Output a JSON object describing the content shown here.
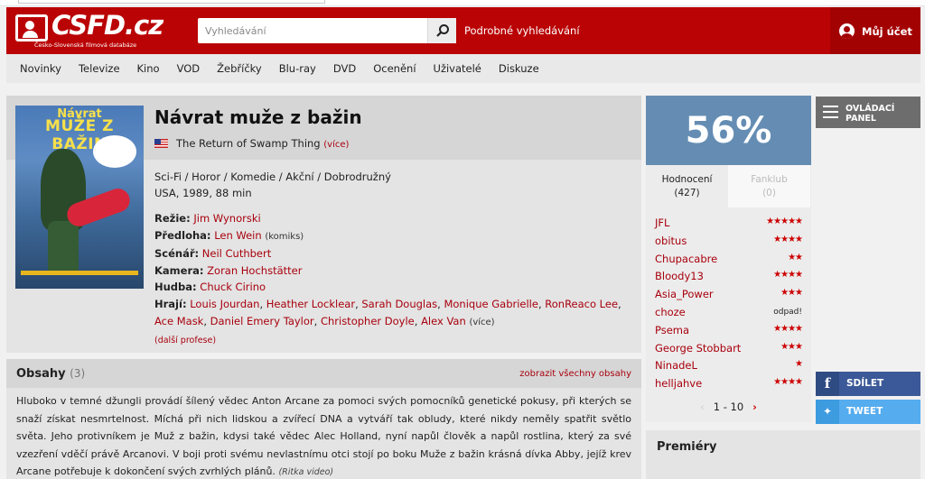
{
  "header": {
    "logo_text": "CSFD.cz",
    "logo_tagline": "Česko-Slovenská filmová databáze",
    "search_placeholder": "Vyhledávání",
    "advanced_search": "Podrobné vyhledávání",
    "account_label": "Můj účet",
    "brand_color": "#ba0305"
  },
  "nav": [
    "Novinky",
    "Televize",
    "Kino",
    "VOD",
    "Žebříčky",
    "Blu-ray",
    "DVD",
    "Ocenění",
    "Uživatelé",
    "Diskuze"
  ],
  "film": {
    "title": "Návrat muže z bažin",
    "poster_title_line1": "Návrat",
    "poster_title_line2": "MUŽE Z BAŽIN",
    "original_title": "The Return of Swamp Thing",
    "original_more": "(více)",
    "genres": "Sci-Fi / Horor / Komedie / Akční / Dobrodružný",
    "origin": "USA, 1989, 88 min",
    "directing_label": "Režie:",
    "director": "Jim Wynorski",
    "source_label": "Předloha:",
    "source": "Len Wein",
    "source_note": "(komiks)",
    "writer_label": "Scénář:",
    "writer": "Neil Cuthbert",
    "camera_label": "Kamera:",
    "camera": "Zoran Hochstätter",
    "music_label": "Hudba:",
    "music": "Chuck Cirino",
    "cast_label": "Hrají:",
    "cast": [
      "Louis Jourdan",
      "Heather Locklear",
      "Sarah Douglas",
      "Monique Gabrielle",
      "RonReaco Lee",
      "Ace Mask",
      "Daniel Emery Taylor",
      "Christopher Doyle",
      "Alex Van"
    ],
    "cast_more": "(více)",
    "more_professions": "(další profese)"
  },
  "plot": {
    "heading": "Obsahy",
    "count": "(3)",
    "show_all": "zobrazit všechny obsahy",
    "text": "Hluboko v temné džungli provádí šílený vědec Anton Arcane za pomoci svých pomocníků genetické pokusy, při kterých se snaží získat nesmrtelnost. Míchá při nich lidskou a zvířecí DNA a vytváří tak obludy, které nikdy neměly spatřit světlo světa. Jeho protivníkem je Muž z bažin, kdysi také vědec Alec Holland, nyní napůl člověk a napůl rostlina, který za své vzezření vděčí právě Arcanovi. V boji proti svému nevlastnímu otci stojí po boku Muže z bažin krásná dívka Abby, jejíž krev Arcane potřebuje k dokončení svých zvrhlých plánů.",
    "source": "(Ritka video)"
  },
  "rating": {
    "score": "56%",
    "score_color": "#658db3",
    "tab_ratings": "Hodnocení",
    "tab_ratings_count": "(427)",
    "tab_fanclub": "Fanklub",
    "tab_fanclub_count": "(0)",
    "raters": [
      {
        "name": "JFL",
        "stars": "★★★★★"
      },
      {
        "name": "obitus",
        "stars": "★★★★"
      },
      {
        "name": "Chupacabre",
        "stars": "★★"
      },
      {
        "name": "Bloody13",
        "stars": "★★★★"
      },
      {
        "name": "Asia_Power",
        "stars": "★★★"
      },
      {
        "name": "choze",
        "stars": "odpad!"
      },
      {
        "name": "Psema",
        "stars": "★★★★"
      },
      {
        "name": "George Stobbart",
        "stars": "★★★"
      },
      {
        "name": "NinadeL",
        "stars": "★"
      },
      {
        "name": "helljahve",
        "stars": "★★★★"
      }
    ],
    "pager": "1 - 10"
  },
  "sidebar": {
    "control_panel_line1": "OVLÁDACÍ",
    "control_panel_line2": "PANEL",
    "share_fb": "SDÍLET",
    "share_tw": "TWEET",
    "premieres": "Premiéry"
  }
}
